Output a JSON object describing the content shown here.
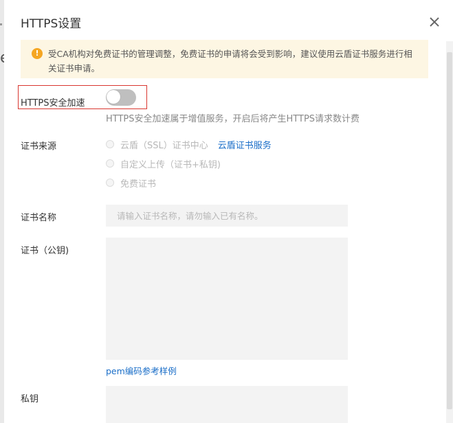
{
  "background": {
    "partial_letter": "e"
  },
  "modal": {
    "title": "HTTPS设置",
    "notice": "受CA机构对免费证书的管理调整，免费证书的申请将会受到影响，建议使用云盾证书服务进行相关证书申请。",
    "https_acceleration": {
      "label": "HTTPS安全加速",
      "enabled": false,
      "hint": "HTTPS安全加速属于增值服务，开启后将产生HTTPS请求数计费"
    },
    "cert_source": {
      "label": "证书来源",
      "options": [
        {
          "label": "云盾（SSL）证书中心",
          "link": "云盾证书服务"
        },
        {
          "label": "自定义上传（证书+私钥)"
        },
        {
          "label": "免费证书"
        }
      ]
    },
    "cert_name": {
      "label": "证书名称",
      "placeholder": "请输入证书名称，请勿输入已有名称。",
      "value": ""
    },
    "cert_public_key": {
      "label": "证书（公钥)",
      "value": "",
      "pem_link": "pem编码参考样例"
    },
    "private_key": {
      "label": "私钥",
      "value": ""
    }
  },
  "colors": {
    "accent": "#1a6ec8",
    "warning": "#f5a623",
    "highlight_border": "#d9362f",
    "toggle_off": "#bfbfbf"
  }
}
